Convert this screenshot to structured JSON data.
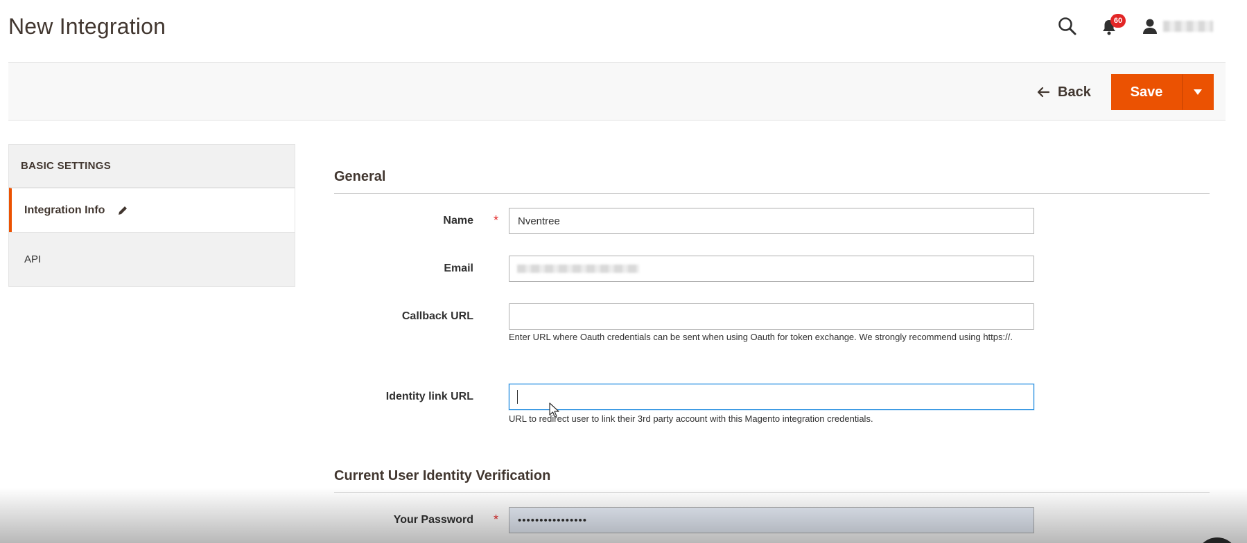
{
  "header": {
    "title": "New Integration",
    "notifications_count": "60",
    "icons": {
      "search": "search-icon",
      "notifications": "bell-icon",
      "account": "user-icon"
    }
  },
  "action_bar": {
    "back_label": "Back",
    "save_label": "Save"
  },
  "sidebar": {
    "title": "BASIC SETTINGS",
    "items": [
      {
        "label": "Integration Info",
        "active": true
      },
      {
        "label": "API",
        "active": false
      }
    ]
  },
  "general": {
    "title": "General",
    "name_label": "Name",
    "name_value": "Nventree",
    "email_label": "Email",
    "callback_label": "Callback URL",
    "callback_value": "",
    "callback_note": "Enter URL where Oauth credentials can be sent when using Oauth for token exchange. We strongly recommend using https://.",
    "identity_label": "Identity link URL",
    "identity_value": "",
    "identity_note": "URL to redirect user to link their 3rd party account with this Magento integration credentials."
  },
  "verification": {
    "title": "Current User Identity Verification",
    "password_label": "Your Password",
    "password_value": "••••••••••••••••"
  },
  "colors": {
    "accent": "#eb5202",
    "required": "#e22626",
    "focus": "#007bdb"
  }
}
